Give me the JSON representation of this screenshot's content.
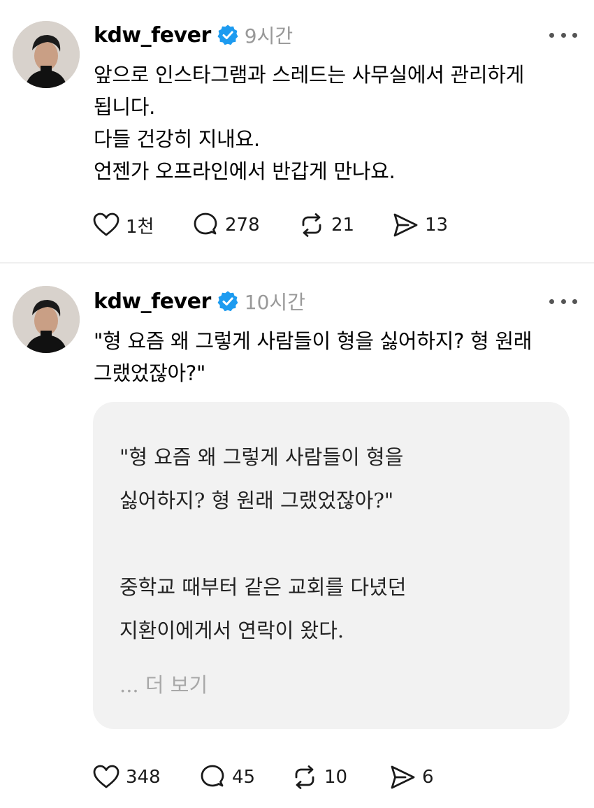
{
  "colors": {
    "verified": "#1d9bf0",
    "muted_text": "#999999",
    "card_background": "#f2f2f2",
    "see_more": "#a8a8a8"
  },
  "posts": [
    {
      "username": "kdw_fever",
      "verified": true,
      "time": "9시간",
      "body_lines": [
        "앞으로 인스타그램과 스레드는 사무실에서 관리하게",
        "됩니다.",
        "다들 건강히 지내요.",
        "언젠가 오프라인에서 반갑게 만나요."
      ],
      "likes": "1천",
      "comments": "278",
      "reposts": "21",
      "shares": "13"
    },
    {
      "username": "kdw_fever",
      "verified": true,
      "time": "10시간",
      "body_lines": [
        "\"형 요즘 왜 그렇게 사람들이 형을 싫어하지? 형 원래",
        "그랬었잖아?\""
      ],
      "quote_lines": [
        "\"형 요즘 왜 그렇게 사람들이 형을",
        "싫어하지? 형 원래 그랬었잖아?\"",
        "",
        "중학교 때부터 같은 교회를 다녔던",
        "지환이에게서 연락이 왔다."
      ],
      "see_more": "... 더 보기",
      "likes": "348",
      "comments": "45",
      "reposts": "10",
      "shares": "6"
    }
  ]
}
